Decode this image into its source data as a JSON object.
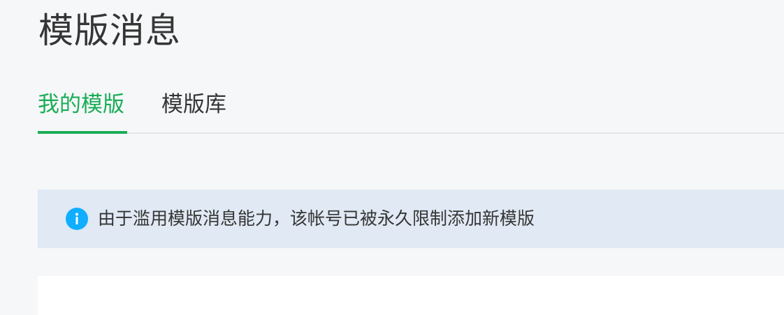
{
  "page": {
    "title": "模版消息"
  },
  "tabs": [
    {
      "label": "我的模版",
      "active": true
    },
    {
      "label": "模版库",
      "active": false
    }
  ],
  "notice": {
    "icon": "info-icon",
    "text": "由于滥用模版消息能力，该帐号已被永久限制添加新模版"
  },
  "colors": {
    "accent": "#1aad56",
    "info": "#10aeff",
    "notice_bg": "#e0e9f4",
    "page_bg": "#f6f7f9"
  }
}
